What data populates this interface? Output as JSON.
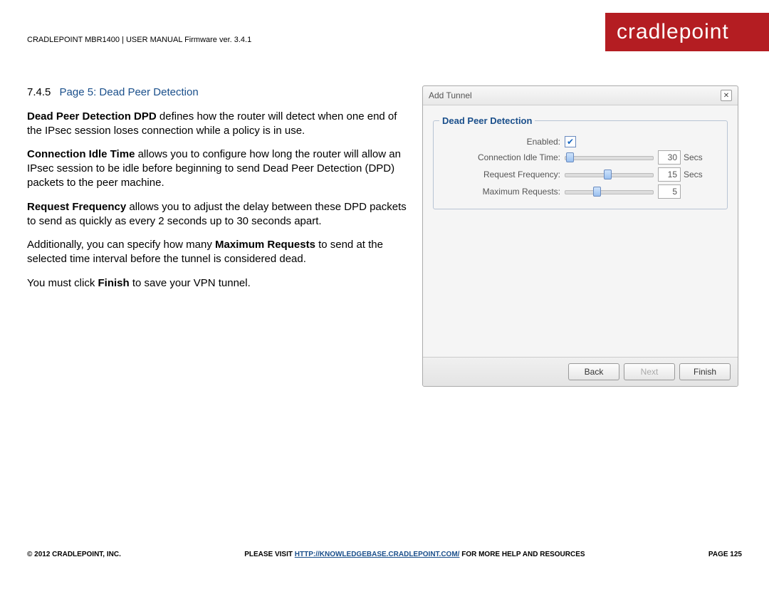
{
  "header": {
    "line": "CRADLEPOINT MBR1400 | USER MANUAL Firmware ver. 3.4.1"
  },
  "brand": "cradlepoint",
  "section": {
    "num": "7.4.5",
    "title": "Page 5: Dead Peer Detection"
  },
  "paras": {
    "p1_bold": "Dead Peer Detection DPD",
    "p1_rest": " defines how the router will detect when one end of the IPsec session loses connection while a policy is in use.",
    "p2_bold": "Connection Idle Time",
    "p2_rest": " allows you to configure how long the router will allow an IPsec session to be idle before beginning to send Dead Peer Detection (DPD) packets to the peer machine.",
    "p3_bold": "Request Frequency",
    "p3_rest": " allows you to adjust the delay between these DPD packets to send as quickly as every 2 seconds up to 30 seconds apart.",
    "p4_pre": "Additionally, you can specify how many ",
    "p4_bold": "Maximum Requests",
    "p4_rest": " to send at the selected time interval before the tunnel is considered dead.",
    "p5_pre": "You must click ",
    "p5_bold": "Finish",
    "p5_rest": " to save your VPN tunnel."
  },
  "dialog": {
    "title": "Add Tunnel",
    "group_title": "Dead Peer Detection",
    "labels": {
      "enabled": "Enabled:",
      "idle": "Connection Idle Time:",
      "freq": "Request Frequency:",
      "max": "Maximum Requests:"
    },
    "values": {
      "enabled": true,
      "idle": "30",
      "freq": "15",
      "max": "5"
    },
    "unit": "Secs",
    "buttons": {
      "back": "Back",
      "next": "Next",
      "finish": "Finish"
    }
  },
  "footer": {
    "left": "© 2012 CRADLEPOINT, INC.",
    "mid_pre": "PLEASE VISIT ",
    "mid_link": "HTTP://KNOWLEDGEBASE.CRADLEPOINT.COM/",
    "mid_post": " FOR MORE HELP AND RESOURCES",
    "right": "PAGE 125"
  }
}
